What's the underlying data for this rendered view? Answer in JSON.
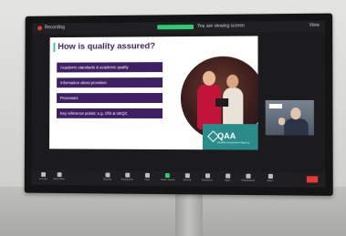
{
  "meeting": {
    "recording_label": "Recording",
    "share_status": "You are viewing screen",
    "view_label": "View"
  },
  "slide": {
    "title": "How is quality assured?",
    "bullets": [
      "Academic standards & academic quality",
      "Information about provision",
      "Processes",
      "Key reference points: e.g. OfS & UKQC"
    ],
    "logo_text": "QAA",
    "logo_tagline": "Quality Assurance Agency"
  },
  "toolbar": {
    "items": [
      "Unmute",
      "Start Video",
      "Security",
      "Participants",
      "Chat",
      "Share Screen",
      "Record",
      "Reactions",
      "Apps",
      "Whiteboards",
      "More"
    ]
  },
  "colors": {
    "slide_purple": "#3f1f63",
    "qaa_teal": "#2a8c8a",
    "share_green": "#2ecc71",
    "end_red": "#e53935"
  }
}
